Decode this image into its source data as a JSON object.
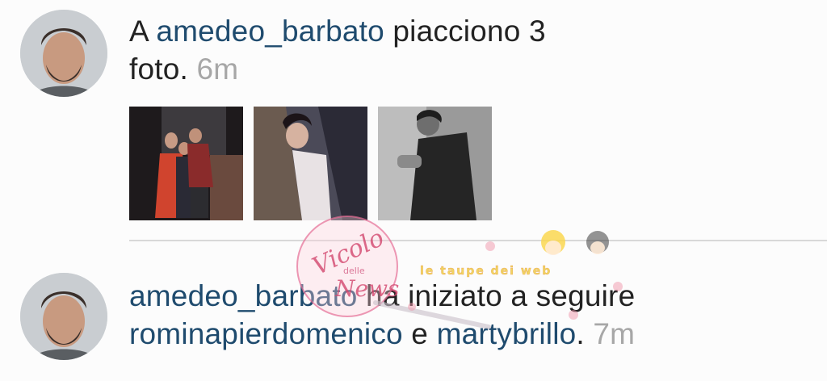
{
  "notifications": [
    {
      "prefix": "A ",
      "username": "amedeo_barbato",
      "action_line1": " piacciono 3",
      "action_line2": "foto.",
      "time": "6m",
      "photos": [
        "group-photo",
        "woman-portrait",
        "man-bw-photo"
      ]
    },
    {
      "username": "amedeo_barbato",
      "action": " ha iniziato a seguire",
      "followed_1": "rominapierdomenico",
      "conjunction": " e ",
      "followed_2": "martybrillo",
      "suffix": ".",
      "time": "7m"
    }
  ],
  "watermark": {
    "logo_line1": "Vicolo",
    "logo_line2": "delle",
    "logo_line3": "News",
    "banner": "le taupe dei web"
  },
  "colors": {
    "username": "#1f4b6e",
    "time": "#a7a7a7",
    "text": "#222222",
    "divider": "#d8d8d8"
  }
}
